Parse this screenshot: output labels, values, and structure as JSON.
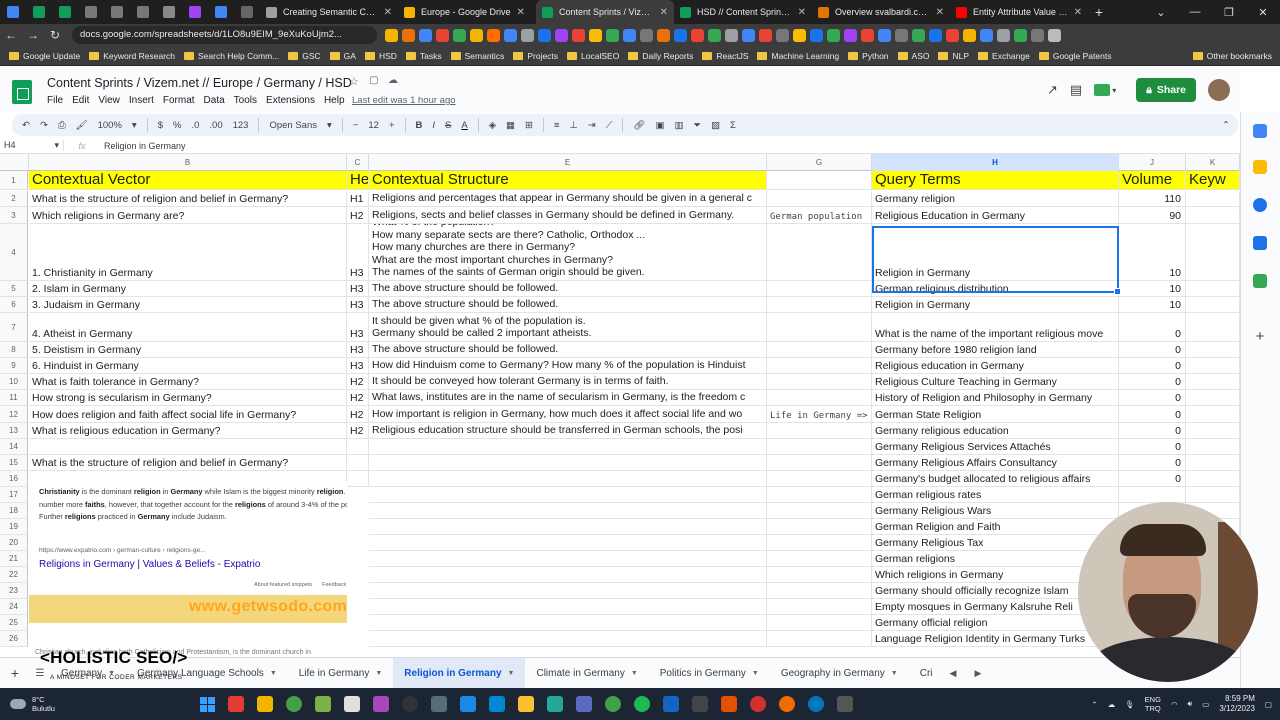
{
  "browser": {
    "tabs": [
      {
        "title": "Creating Semantic Content",
        "color": "#9aa0a6"
      },
      {
        "title": "Europe - Google Drive",
        "color": "#f4b400"
      },
      {
        "title": "Content Sprints / Vizem.ne",
        "color": "#0f9d58",
        "active": true
      },
      {
        "title": "HSD // Content Sprints / S",
        "color": "#0f9d58"
      },
      {
        "title": "Overview svalbardi.com",
        "color": "#e37400"
      },
      {
        "title": "Entity Attribute Value (EAV",
        "color": "#ff0000"
      }
    ],
    "url": "docs.google.com/spreadsheets/d/1LO8u9EIM_9eXuKoUjm2...",
    "bookmarks": [
      "Google Update",
      "Keyword Research",
      "Search Help Comm...",
      "GSC",
      "GA",
      "HSD",
      "Tasks",
      "Semantics",
      "Projects",
      "LocalSEO",
      "Daily Reports",
      "ReactJS",
      "Machine Learning",
      "Python",
      "ASO",
      "NLP",
      "Exchange",
      "Google Patents"
    ],
    "other_bookmarks": "Other bookmarks"
  },
  "sheet": {
    "title": "Content Sprints / Vizem.net // Europe / Germany / HSD",
    "menus": [
      "File",
      "Edit",
      "View",
      "Insert",
      "Format",
      "Data",
      "Tools",
      "Extensions",
      "Help"
    ],
    "last_edit": "Last edit was 1 hour ago",
    "share_label": "Share",
    "toolbar": {
      "zoom": "100%",
      "currency": "$",
      "percent": "%",
      "dec_less": ".0",
      "dec_more": ".00",
      "format": "123",
      "font": "Open Sans",
      "size": "12",
      "bold": "B",
      "italic": "I",
      "strike": "S",
      "text_color": "A"
    },
    "name_box": "H4",
    "formula_value": "Religion in Germany",
    "columns": [
      {
        "label": "B"
      },
      {
        "label": "C"
      },
      {
        "label": "E"
      },
      {
        "label": "G"
      },
      {
        "label": "H",
        "selected": true
      },
      {
        "label": "J"
      },
      {
        "label": "K"
      }
    ],
    "row_numbers": [
      "1",
      "2",
      "3",
      "4",
      "5",
      "6",
      "7",
      "8",
      "9",
      "10",
      "11",
      "12",
      "13",
      "14",
      "15",
      "16",
      "17",
      "18",
      "19",
      "20",
      "21",
      "22",
      "23",
      "24",
      "25",
      "26"
    ],
    "headers": {
      "vector": "Contextual Vector",
      "heading": "He",
      "structure": "Contextual Structure",
      "query": "Query Terms",
      "volume": "Volume",
      "keyword": "Keyw"
    },
    "rows": [
      {
        "vector": "What is the structure of religion and belief in Germany?",
        "heading": "H1",
        "structure": "Religions and percentages that appear in Germany should be given in a general c",
        "g": "",
        "query": "Germany religion",
        "volume": "110"
      },
      {
        "vector": "Which religions in Germany are?",
        "heading": "H2",
        "structure": "Religions, sects and belief classes in Germany should be defined in Germany.",
        "g": "German population",
        "query": "Religious Education in Germany",
        "volume": "90"
      },
      {
        "vector": "1. Christianity in Germany",
        "heading": "H3",
        "structure": "What % of the population?\nHow many separate sects are there? Catholic, Orthodox ...\nHow many churches are there in Germany?\nWhat are the most important churches in Germany?\nThe names of the saints of German origin should be given.",
        "g": "",
        "query": "Religion in Germany",
        "volume": "10"
      },
      {
        "vector": "2. Islam in Germany",
        "heading": "H3",
        "structure": "The above structure should be followed.",
        "g": "",
        "query": "German religious distribution",
        "volume": "10"
      },
      {
        "vector": "3. Judaism in Germany",
        "heading": "H3",
        "structure": "The above structure should be followed.",
        "g": "",
        "query": "Religion in Germany",
        "volume": "10"
      },
      {
        "vector": "4. Atheist in Germany",
        "heading": "H3",
        "structure": "It should be given what % of the population is.\nGermany should be called 2 important atheists.",
        "g": "",
        "query": "What is the name of the important religious move",
        "volume": "0"
      },
      {
        "vector": "5. Deistism in Germany",
        "heading": "H3",
        "structure": "The above structure should be followed.",
        "g": "",
        "query": "Germany before 1980 religion land",
        "volume": "0"
      },
      {
        "vector": "6. Hinduist in Germany",
        "heading": "H3",
        "structure": "How did Hinduism come to Germany? How many % of the population is Hinduist",
        "g": "",
        "query": "Religious education in Germany",
        "volume": "0"
      },
      {
        "vector": "What is faith tolerance in Germany?",
        "heading": "H2",
        "structure": "It should be conveyed how tolerant Germany is in terms of faith.",
        "g": "",
        "query": "Religious Culture Teaching in Germany",
        "volume": "0"
      },
      {
        "vector": "How strong is secularism in Germany?",
        "heading": "H2",
        "structure": "What laws, institutes are in the name of secularism in Germany, is the freedom c",
        "g": "",
        "query": "History of Religion and Philosophy in Germany",
        "volume": "0"
      },
      {
        "vector": "How does religion and faith affect social life in Germany?",
        "heading": "H2",
        "structure": "How important is religion in Germany, how much does it affect social life and wo",
        "g": "Life in Germany =>",
        "query": "German State Religion",
        "volume": "0"
      },
      {
        "vector": "What is religious education in Germany?",
        "heading": "H2",
        "structure": "Religious education structure should be transferred in German schools, the posi",
        "g": "",
        "query": "Germany religious education",
        "volume": "0"
      },
      {
        "vector": "",
        "heading": "",
        "structure": "",
        "g": "",
        "query": "Germany Religious Services Attachés",
        "volume": "0"
      },
      {
        "vector": "What is the structure of religion and belief in Germany?",
        "heading": "",
        "structure": "",
        "g": "",
        "query": "Germany Religious Affairs Consultancy",
        "volume": "0"
      },
      {
        "vector": "",
        "heading": "",
        "structure": "",
        "g": "",
        "query": "Germany's budget allocated to religious affairs",
        "volume": "0"
      },
      {
        "vector": "",
        "heading": "",
        "structure": "",
        "g": "",
        "query": "German religious rates",
        "volume": ""
      },
      {
        "vector": "",
        "heading": "",
        "structure": "",
        "g": "",
        "query": "Germany Religious Wars",
        "volume": ""
      },
      {
        "vector": "",
        "heading": "",
        "structure": "",
        "g": "",
        "query": "German Religion and Faith",
        "volume": ""
      },
      {
        "vector": "",
        "heading": "",
        "structure": "",
        "g": "",
        "query": "Germany Religious Tax",
        "volume": ""
      },
      {
        "vector": "",
        "heading": "",
        "structure": "",
        "g": "",
        "query": "German religions",
        "volume": ""
      },
      {
        "vector": "",
        "heading": "",
        "structure": "",
        "g": "",
        "query": "Which religions in Germany",
        "volume": ""
      },
      {
        "vector": "",
        "heading": "",
        "structure": "",
        "g": "",
        "query": "Germany should officially recognize Islam",
        "volume": ""
      },
      {
        "vector": "",
        "heading": "",
        "structure": "",
        "g": "",
        "query": "Empty mosques in Germany Kalsruhe Reli",
        "volume": ""
      },
      {
        "vector": "",
        "heading": "",
        "structure": "",
        "g": "",
        "query": "Germany official religion",
        "volume": ""
      },
      {
        "vector": "",
        "heading": "",
        "structure": "",
        "g": "",
        "query": "Language Religion Identity in Germany Turks",
        "volume": ""
      }
    ],
    "snippet": {
      "text_html": "<b>Christianity</b> is the dominant <b>religion</b> in <b>Germany</b> while Islam is the biggest minority <b>religion</b>. There are a number more <b>faiths</b>, however, that together account for the <b>religions</b> of around 3-4% of the population. Further <b>religions</b> practiced in <b>Germany</b> include Judaism.",
      "source": "https://www.expatrio.com › german-culture › religions-ge...",
      "link": "Religions in Germany | Values & Beliefs - Expatrio",
      "foot1": "About featured snippets",
      "foot2": "Feedback",
      "watermark": "www.getwsodo.com",
      "bottom": "Christian church, including both Catholicism and Protestantism, is the dominant church in"
    },
    "tabs": [
      "Germany",
      "Germany Language Schools",
      "Life in Germany",
      "Religion in Germany",
      "Climate in Germany",
      "Politics in Germany",
      "Geography in Germany",
      "Cri"
    ],
    "active_tab": "Religion in Germany"
  },
  "overlay": {
    "brand": "<HOLISTIC SEO/>",
    "tagline": "A MINDSET FOR CODER MARKETERS"
  },
  "taskbar": {
    "temp": "8°C",
    "weather": "Bulutlu",
    "lang1": "ENG",
    "lang2": "TRQ",
    "time": "8:59 PM",
    "date": "3/12/2023"
  }
}
